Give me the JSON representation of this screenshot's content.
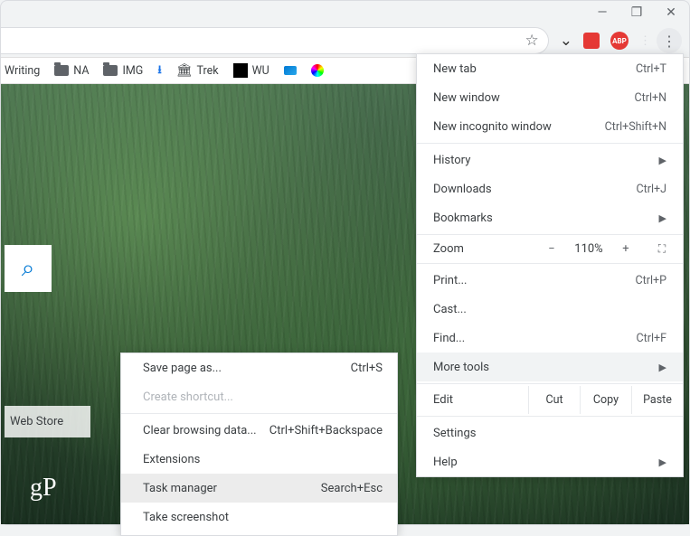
{
  "bookmarks": {
    "writing": "Writing",
    "na": "NA",
    "img": "IMG",
    "trek": "Trek",
    "wu": "WU"
  },
  "extensions": {
    "red_box": "■",
    "abp": "ABP"
  },
  "ntp": {
    "web_store": "Web Store",
    "logo": "gP"
  },
  "menu": {
    "new_tab": {
      "label": "New tab",
      "shortcut": "Ctrl+T"
    },
    "new_window": {
      "label": "New window",
      "shortcut": "Ctrl+N"
    },
    "incognito": {
      "label": "New incognito window",
      "shortcut": "Ctrl+Shift+N"
    },
    "history": {
      "label": "History"
    },
    "downloads": {
      "label": "Downloads",
      "shortcut": "Ctrl+J"
    },
    "bookmarks": {
      "label": "Bookmarks"
    },
    "zoom": {
      "label": "Zoom",
      "value": "110%"
    },
    "print": {
      "label": "Print...",
      "shortcut": "Ctrl+P"
    },
    "cast": {
      "label": "Cast..."
    },
    "find": {
      "label": "Find...",
      "shortcut": "Ctrl+F"
    },
    "more_tools": {
      "label": "More tools"
    },
    "edit": {
      "label": "Edit",
      "cut": "Cut",
      "copy": "Copy",
      "paste": "Paste"
    },
    "settings": {
      "label": "Settings"
    },
    "help": {
      "label": "Help"
    }
  },
  "submenu": {
    "save_page": {
      "label": "Save page as...",
      "shortcut": "Ctrl+S"
    },
    "create_shortcut": {
      "label": "Create shortcut..."
    },
    "clear_data": {
      "label": "Clear browsing data...",
      "shortcut": "Ctrl+Shift+Backspace"
    },
    "extensions": {
      "label": "Extensions"
    },
    "task_manager": {
      "label": "Task manager",
      "shortcut": "Search+Esc"
    },
    "screenshot": {
      "label": "Take screenshot"
    }
  }
}
